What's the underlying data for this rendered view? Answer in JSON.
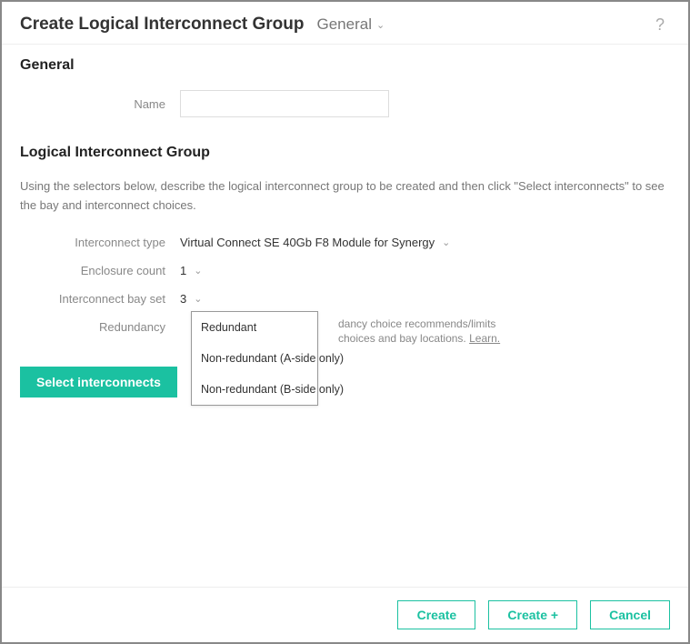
{
  "header": {
    "title": "Create Logical Interconnect Group",
    "section": "General",
    "help_icon": "?"
  },
  "general": {
    "heading": "General",
    "name_label": "Name",
    "name_value": ""
  },
  "lig": {
    "heading": "Logical Interconnect Group",
    "description": "Using the selectors below, describe the logical interconnect group to be created and then click \"Select interconnects\" to see the bay and interconnect choices.",
    "interconnect_type_label": "Interconnect type",
    "interconnect_type_value": "Virtual Connect SE 40Gb F8 Module for Synergy",
    "enclosure_count_label": "Enclosure count",
    "enclosure_count_value": "1",
    "bay_set_label": "Interconnect bay set",
    "bay_set_value": "3",
    "redundancy_label": "Redundancy",
    "redundancy_hint_line1": "dancy choice recommends/limits",
    "redundancy_hint_line2": "choices and bay locations.",
    "redundancy_learn": "Learn.",
    "redundancy_options": {
      "opt0": "Redundant",
      "opt1": "Non-redundant (A-side only)",
      "opt2": "Non-redundant (B-side only)"
    },
    "select_interconnects_btn": "Select interconnects"
  },
  "footer": {
    "create": "Create",
    "create_plus": "Create +",
    "cancel": "Cancel"
  }
}
